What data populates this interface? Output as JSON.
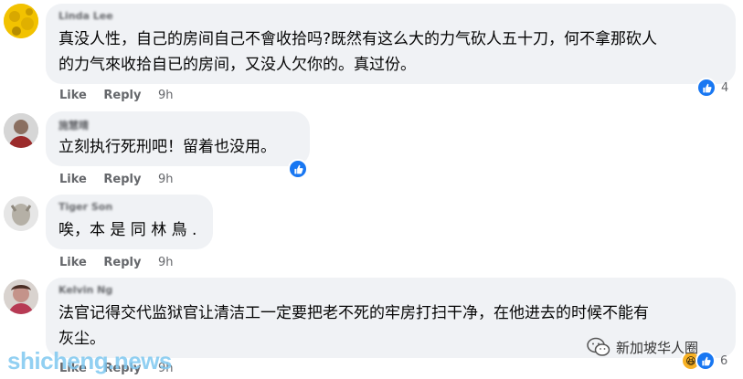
{
  "comments": [
    {
      "author": "Linda Lee",
      "lines": [
        "真没人性，自己的房间自己不會收拾吗?既然有这么大的力气砍人五十刀，何不拿那砍人",
        "的力气來收拾自已的房间，又没人欠你的。真过份。"
      ],
      "like": "Like",
      "reply": "Reply",
      "time": "9h",
      "reaction_count": "4",
      "reactions": [
        "like-icon"
      ]
    },
    {
      "author": "施慧晴",
      "lines": [
        "立刻执行死刑吧！留着也没用。"
      ],
      "like": "Like",
      "reply": "Reply",
      "time": "9h",
      "reaction_count": "",
      "reactions": [
        "like-icon"
      ]
    },
    {
      "author": "Tiger Son",
      "lines": [
        "唉，本 是 同 林 鳥 ."
      ],
      "like": "Like",
      "reply": "Reply",
      "time": "9h",
      "reaction_count": "",
      "reactions": []
    },
    {
      "author": "Kelvin Ng",
      "lines": [
        "法官记得交代监狱官让清洁工一定要把老不死的牢房打扫干净，在他进去的时候不能有",
        "灰尘。"
      ],
      "like": "Like",
      "reply": "Reply",
      "time": "9h",
      "reaction_count": "6",
      "reactions": [
        "haha-icon",
        "like-icon"
      ]
    }
  ],
  "watermark": "shicheng.news",
  "brand": "新加坡华人圈",
  "colors": {
    "bubble": "#f0f2f5",
    "like_blue": "#1877f2",
    "meta_gray": "#65676b"
  }
}
